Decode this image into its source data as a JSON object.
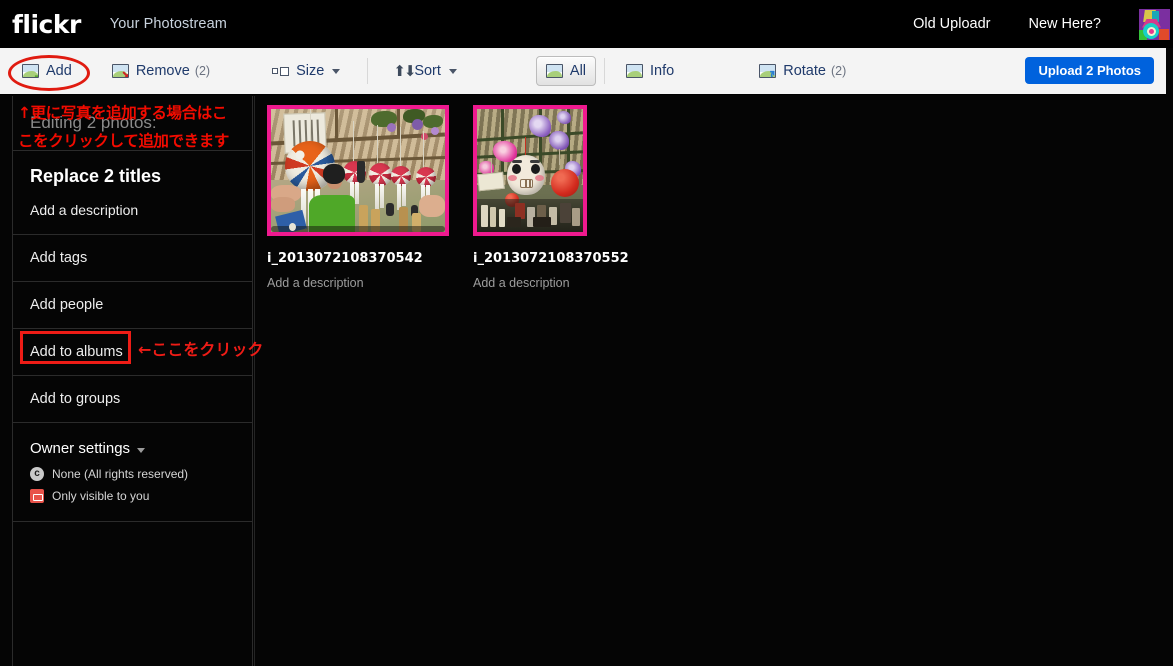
{
  "nav": {
    "brand": "flickr",
    "title": "Your Photostream",
    "links": [
      {
        "label": "Old Uploadr"
      },
      {
        "label": "New Here?"
      }
    ],
    "avatar_name": "user-avatar"
  },
  "toolbar": {
    "add": {
      "label": "Add",
      "icon": "add-photo-icon"
    },
    "remove": {
      "label": "Remove",
      "count": "(2)",
      "icon": "remove-photo-icon"
    },
    "size": {
      "label": "Size",
      "icon": "size-icon"
    },
    "sort": {
      "label": "Sort",
      "icon": "sort-icon"
    },
    "all": {
      "label": "All",
      "icon": "all-photos-icon",
      "active": true
    },
    "info": {
      "label": "Info",
      "icon": "info-photo-icon"
    },
    "rotate": {
      "label": "Rotate",
      "count": "(2)",
      "icon": "rotate-photo-icon"
    },
    "upload_button": {
      "label": "Upload 2 Photos"
    }
  },
  "sidebar": {
    "heading": "Editing 2 photos:",
    "replace_titles": "Replace 2 titles",
    "add_description": "Add a description",
    "rows": [
      {
        "label": "Add tags",
        "name": "add-tags"
      },
      {
        "label": "Add people",
        "name": "add-people"
      },
      {
        "label": "Add to albums",
        "name": "add-to-albums",
        "highlighted": true
      },
      {
        "label": "Add to groups",
        "name": "add-to-groups"
      }
    ],
    "owner_settings": {
      "label": "Owner settings",
      "options": [
        {
          "label": "None (All rights reserved)",
          "icon": "creative-commons-icon"
        },
        {
          "label": "Only visible to you",
          "icon": "lock-icon"
        }
      ]
    }
  },
  "annotations": {
    "jp_line1": "↑更に写真を追加する場合はこ",
    "jp_line2": "こをクリックして追加できます",
    "jp_click_here": "←ここをクリック",
    "ellipse_target": "add-button",
    "rect_target": "add-to-albums-row",
    "color": "#ee1c16"
  },
  "photos": [
    {
      "title": "i_2013072108370542",
      "description": "Add a description",
      "orientation": "landscape",
      "border_color": "#ef1a8f",
      "alt": "Orange and white temari ball wind chime hanging under a wooden pergola"
    },
    {
      "title": "i_2013072108370552",
      "description": "Add a description",
      "orientation": "portrait",
      "border_color": "#ef1a8f",
      "alt": "Daruma face paper lantern with pink and purple morning glory flowers"
    }
  ],
  "colors": {
    "nav_bg": "#000000",
    "toolbar_bg": "#f4f4f4",
    "page_bg": "#050505",
    "accent_blue": "#0062dd",
    "link_navy": "#1f3a6b",
    "photo_border": "#ef1a8f",
    "annotation_red": "#ee1c16"
  }
}
